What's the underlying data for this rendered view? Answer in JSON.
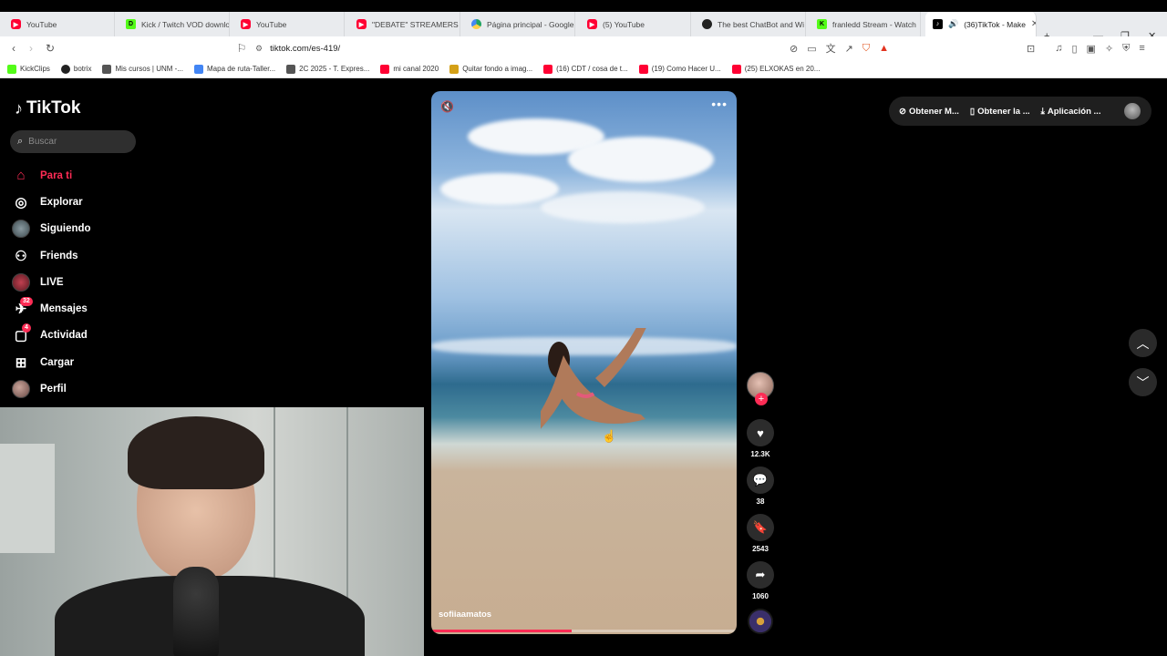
{
  "browser": {
    "tabs": [
      {
        "title": "YouTube",
        "favicon": "youtube-icon"
      },
      {
        "title": "Kick / Twitch VOD downlo",
        "favicon": "kick-icon"
      },
      {
        "title": "YouTube",
        "favicon": "youtube-icon"
      },
      {
        "title": "\"DEBATE\" STREAMERS UN",
        "favicon": "youtube-icon"
      },
      {
        "title": "Página principal - Google",
        "favicon": "google-drive-icon"
      },
      {
        "title": "(5) YouTube",
        "favicon": "youtube-icon"
      },
      {
        "title": "The best ChatBot and Wi",
        "favicon": "chatbot-icon"
      },
      {
        "title": "franledd Stream - Watch",
        "favicon": "kick-icon"
      },
      {
        "title": "(36)TikTok - Make",
        "favicon": "tiktok-icon",
        "active": true
      }
    ],
    "url": "tiktok.com/es-419/",
    "bookmarks": [
      {
        "label": "KickClips",
        "favicon": "kick-icon"
      },
      {
        "label": "botrix",
        "favicon": "bot-icon"
      },
      {
        "label": "Mis cursos | UNM -...",
        "favicon": "link-icon"
      },
      {
        "label": "Mapa de ruta-Taller...",
        "favicon": "docs-icon"
      },
      {
        "label": "2C 2025 - T. Expres...",
        "favicon": "link-icon"
      },
      {
        "label": "mi canal 2020",
        "favicon": "youtube-icon"
      },
      {
        "label": "Quitar fondo a imag...",
        "favicon": "image-icon"
      },
      {
        "label": "(16) CDT / cosa de t...",
        "favicon": "youtube-icon"
      },
      {
        "label": "(19) Como Hacer U...",
        "favicon": "youtube-icon"
      },
      {
        "label": "(25) ELXOKAS en 20...",
        "favicon": "youtube-icon"
      }
    ]
  },
  "tiktok": {
    "logo_text": "TikTok",
    "search_placeholder": "Buscar",
    "nav": [
      {
        "label": "Para ti",
        "icon": "home-icon",
        "active": true
      },
      {
        "label": "Explorar",
        "icon": "compass-icon"
      },
      {
        "label": "Siguiendo",
        "icon": "following-avatar"
      },
      {
        "label": "Friends",
        "icon": "friends-icon"
      },
      {
        "label": "LIVE",
        "icon": "live-avatar"
      },
      {
        "label": "Mensajes",
        "icon": "messages-icon",
        "badge": "32"
      },
      {
        "label": "Actividad",
        "icon": "activity-icon",
        "badge": "4"
      },
      {
        "label": "Cargar",
        "icon": "upload-icon"
      },
      {
        "label": "Perfil",
        "icon": "profile-avatar"
      }
    ],
    "top_actions": [
      {
        "label": "Obtener M...",
        "icon": "coin-icon"
      },
      {
        "label": "Obtener la ...",
        "icon": "phone-icon"
      },
      {
        "label": "Aplicación ...",
        "icon": "download-icon"
      }
    ],
    "video": {
      "username": "sofiiaamatos",
      "progress": 0.46
    },
    "actions": {
      "likes": "12.3K",
      "comments": "38",
      "saves": "2543",
      "shares": "1060"
    },
    "accent_color": "#fe2c55"
  }
}
